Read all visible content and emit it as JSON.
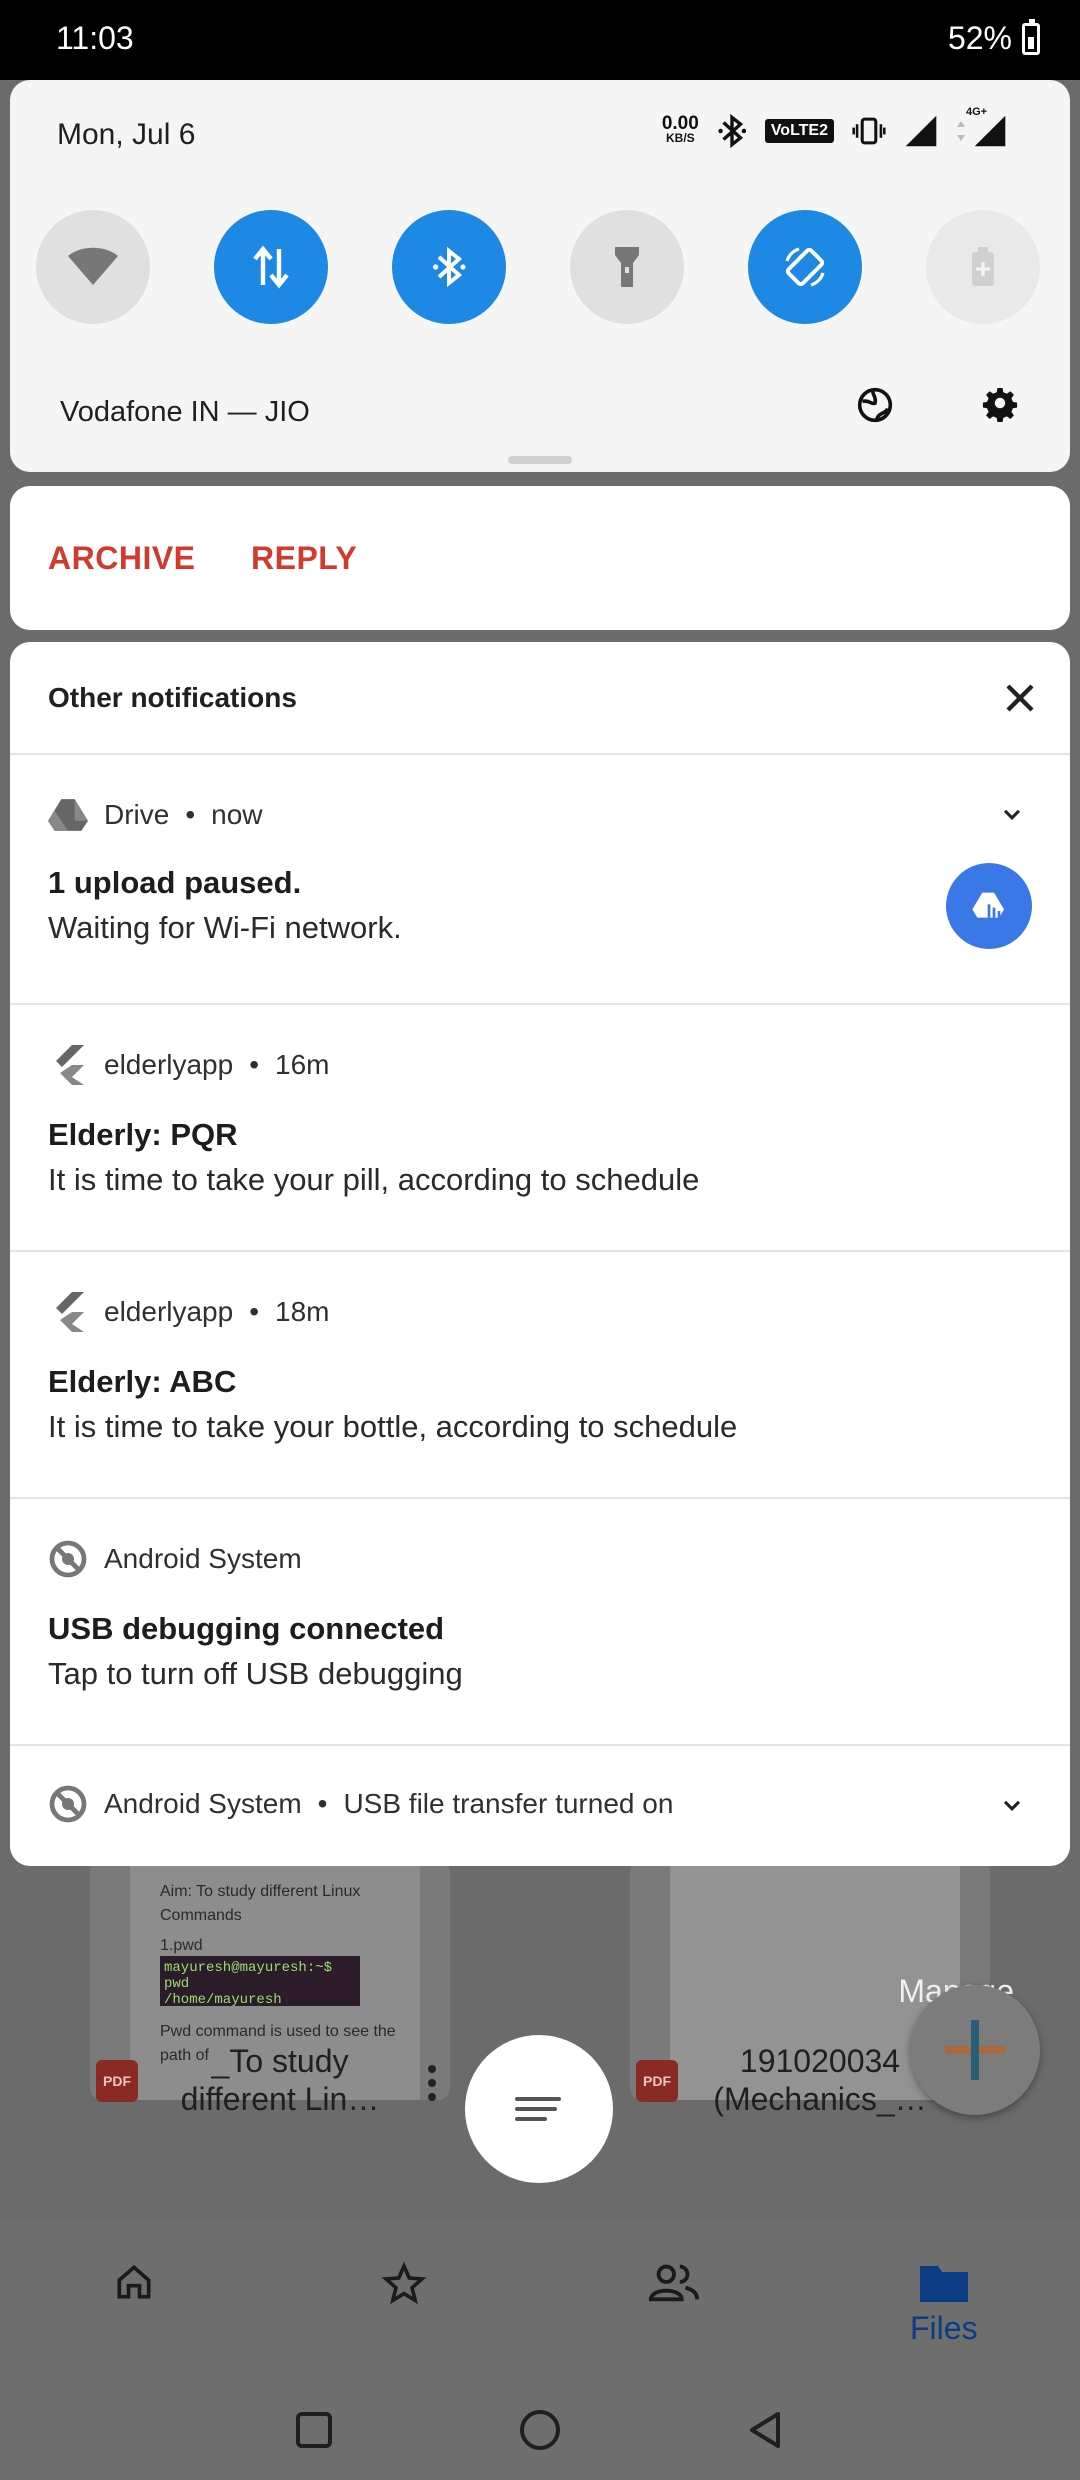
{
  "status_bar": {
    "time": "11:03",
    "battery": "52%"
  },
  "quick_settings": {
    "date": "Mon, Jul 6",
    "net_speed_value": "0.00",
    "net_speed_unit": "KB/S",
    "volte_label": "VoLTE2",
    "signal_tech": "4G+",
    "tiles": [
      {
        "name": "wifi",
        "state": "off"
      },
      {
        "name": "mobile-data",
        "state": "on"
      },
      {
        "name": "bluetooth",
        "state": "on"
      },
      {
        "name": "flashlight",
        "state": "off"
      },
      {
        "name": "auto-rotate",
        "state": "on"
      },
      {
        "name": "battery-saver",
        "state": "unavailable"
      }
    ],
    "carrier": "Vodafone IN — JIO",
    "colors": {
      "tile_on": "#1e88e5",
      "tile_off": "#e0e0e0"
    }
  },
  "message_actions": {
    "archive": "ARCHIVE",
    "reply": "REPLY",
    "accent": "#d23a2e"
  },
  "notifications": {
    "header": "Other notifications",
    "items": [
      {
        "app": "Drive",
        "time": "now",
        "title": "1 upload paused.",
        "text": "Waiting for Wi-Fi network.",
        "icon": "drive-icon"
      },
      {
        "app": "elderlyapp",
        "time": "16m",
        "title": "Elderly: PQR",
        "text": "It is time to take your pill, according to schedule",
        "icon": "flutter-icon"
      },
      {
        "app": "elderlyapp",
        "time": "18m",
        "title": "Elderly: ABC",
        "text": "It is time to take your bottle, according to schedule",
        "icon": "flutter-icon"
      },
      {
        "app": "Android System",
        "title": "USB debugging connected",
        "text": "Tap to turn off USB debugging",
        "icon": "android-system-icon"
      },
      {
        "app": "Android System",
        "summary": "USB file transfer turned on",
        "icon": "android-system-icon"
      }
    ]
  },
  "background_app": {
    "manage_label": "Manage",
    "doc1_text": [
      "Aim: To study different Linux",
      "Commands",
      "1.pwd"
    ],
    "doc1_terminal": [
      "mayuresh@mayuresh:~$ pwd",
      "/home/mayuresh"
    ],
    "doc1_footer": "Pwd command is used to see the path of",
    "pdf_badge": "PDF",
    "file1_name": [
      "_To study",
      "different Lin…"
    ],
    "file2_name": [
      "191020034",
      "(Mechanics_…"
    ],
    "nav_files": "Files"
  }
}
